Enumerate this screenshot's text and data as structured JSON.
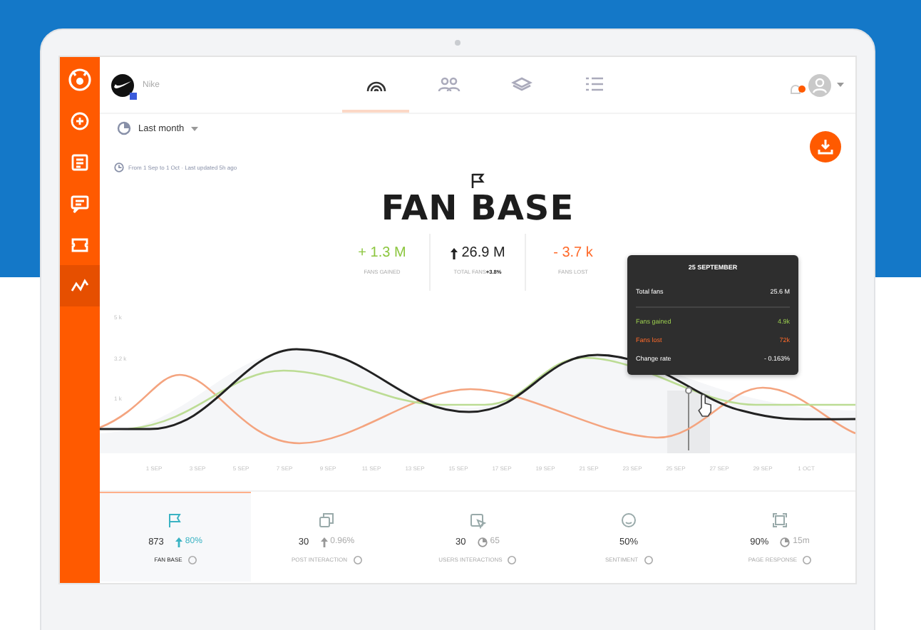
{
  "sidebar": {
    "items": [
      {
        "selected": false
      },
      {
        "selected": false
      },
      {
        "selected": false
      },
      {
        "selected": false
      },
      {
        "selected": true
      }
    ]
  },
  "profile": {
    "name": "Nike"
  },
  "nav_tabs": [
    {
      "selected": true
    },
    {
      "selected": false
    },
    {
      "selected": false
    },
    {
      "selected": false
    }
  ],
  "period": {
    "value": "Last month"
  },
  "info": "From 1 Sep to 1 Oct · Last updated 5h ago",
  "title": "FAN BASE",
  "stats": [
    {
      "kind": "gain",
      "value": "+ 1.3 M",
      "label": "FANS GAINED"
    },
    {
      "kind": "total",
      "value": "26.9 M",
      "label": "TOTAL FANS",
      "change": "+3.8%"
    },
    {
      "kind": "loss",
      "value": "- 3.7 k",
      "label": "FANS LOST"
    }
  ],
  "tooltip": {
    "title": "25 SEPTEMBER",
    "rows": [
      {
        "kind": "total",
        "label": "Total fans",
        "value": "25.6 M"
      },
      {
        "kind": "gain",
        "label": "Fans gained",
        "value": "4.9k"
      },
      {
        "kind": "loss",
        "label": "Fans lost",
        "value": "72k"
      },
      {
        "kind": "rate",
        "label": "Change rate",
        "value": "- 0.163%"
      }
    ]
  },
  "chart": {
    "y_labels": [
      "5 k",
      "3.2 k",
      "1 k"
    ],
    "x_labels": [
      "1 SEP",
      "3 SEP",
      "5 SEP",
      "7 SEP",
      "9 SEP",
      "11 SEP",
      "13 SEP",
      "15 SEP",
      "17 SEP",
      "19 SEP",
      "21 SEP",
      "23 SEP",
      "25 SEP",
      "27 SEP",
      "29 SEP",
      "1 OCT"
    ]
  },
  "metrics": [
    {
      "kind": "up",
      "value": "873",
      "delta": "80%",
      "label": "FAN BASE",
      "selected": true
    },
    {
      "kind": "up",
      "value": "30",
      "delta": "0.96%",
      "label": "POST INTERACTION",
      "selected": false
    },
    {
      "kind": "timer",
      "value": "30",
      "delta": "65",
      "label": "USERS INTERACTIONS",
      "selected": false
    },
    {
      "value": "50%",
      "label": "SENTIMENT",
      "selected": false
    },
    {
      "kind": "timer",
      "value": "90%",
      "delta": "15m",
      "label": "PAGE RESPONSE",
      "selected": false
    }
  ]
}
